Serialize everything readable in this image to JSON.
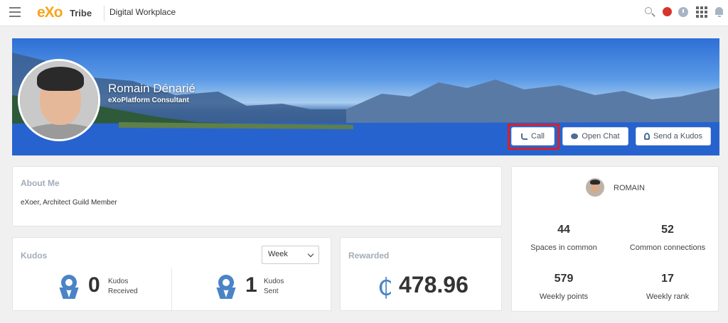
{
  "topbar": {
    "logo_text": "eXo",
    "company": "Tribe",
    "site": "Digital Workplace"
  },
  "profile": {
    "name": "Romain Dénarié",
    "role": "eXoPlatform Consultant",
    "buttons": {
      "call": "Call",
      "open_chat": "Open Chat",
      "send_kudos": "Send a Kudos"
    }
  },
  "about": {
    "title": "About Me",
    "text": "eXoer, Architect Guild Member"
  },
  "kudos": {
    "title": "Kudos",
    "period": "Week",
    "received_count": "0",
    "received_label_1": "Kudos",
    "received_label_2": "Received",
    "sent_count": "1",
    "sent_label_1": "Kudos",
    "sent_label_2": "Sent"
  },
  "rewarded": {
    "title": "Rewarded",
    "symbol": "₵",
    "value": "478.96"
  },
  "stats": {
    "user": "ROMAIN",
    "items": [
      {
        "value": "44",
        "label": "Spaces in common"
      },
      {
        "value": "52",
        "label": "Common connections"
      },
      {
        "value": "579",
        "label": "Weekly points"
      },
      {
        "value": "17",
        "label": "Weekly rank"
      }
    ]
  },
  "colors": {
    "highlight": "#d5212b",
    "accent": "#4a84c6",
    "brand": "#f6a51a"
  }
}
